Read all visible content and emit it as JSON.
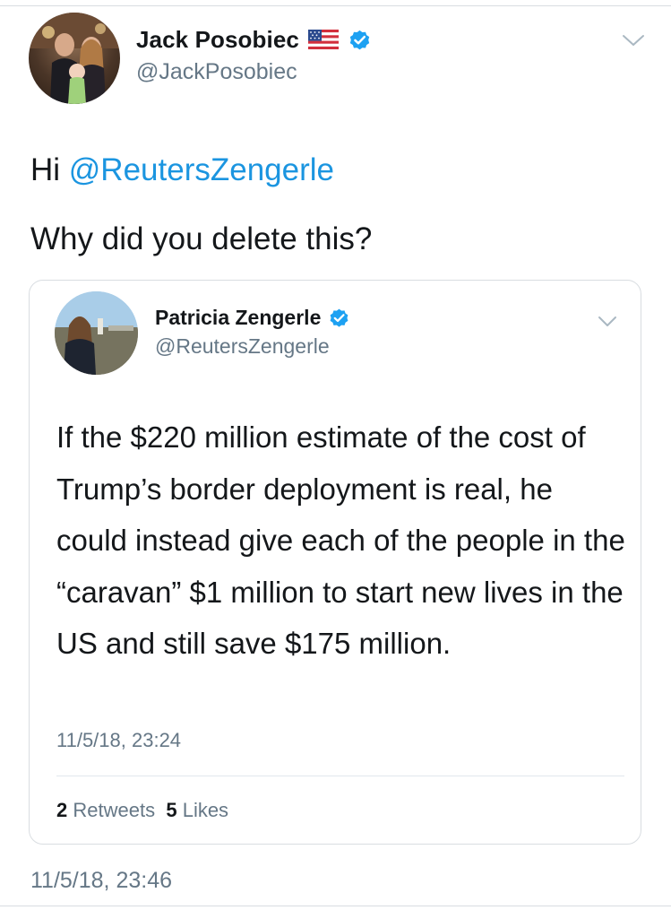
{
  "tweet": {
    "author": {
      "display_name": "Jack Posobiec",
      "handle": "@JackPosobiec",
      "badge_icons": [
        "us-flag-icon",
        "verified-badge-icon"
      ]
    },
    "menu_icon": "chevron-down-icon",
    "text_line1_prefix": "Hi ",
    "text_line1_mention": "@ReutersZengerle",
    "text_line2": "Why did you delete this?",
    "timestamp": "11/5/18, 23:46",
    "quoted_tweet": {
      "author": {
        "display_name": "Patricia Zengerle",
        "handle": "@ReutersZengerle",
        "badge_icons": [
          "verified-badge-icon"
        ]
      },
      "menu_icon": "chevron-down-icon",
      "text": "If the $220 million estimate of the cost of Trump’s border deployment is real, he could instead give each of the people in the “caravan” $1 million to start new lives in the US and still save $175 million.",
      "timestamp": "11/5/18, 23:24",
      "stats": {
        "retweets_count": "2",
        "retweets_label": "Retweets",
        "likes_count": "5",
        "likes_label": "Likes"
      }
    }
  },
  "colors": {
    "link_blue": "#1b95e0",
    "verified_blue": "#1da1f2",
    "secondary_gray": "#657786",
    "text_dark": "#14171a",
    "border_gray": "#d9dde1"
  }
}
